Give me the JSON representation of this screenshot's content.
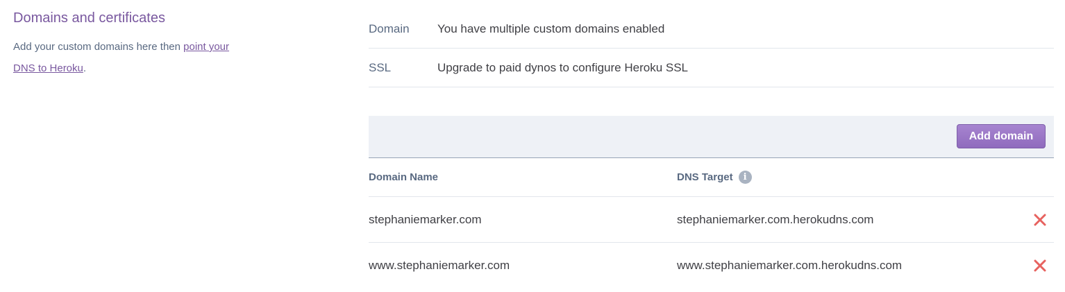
{
  "section": {
    "title": "Domains and certificates",
    "description_prefix": "Add your custom domains here then ",
    "link_text": "point your DNS to Heroku",
    "description_suffix": "."
  },
  "info_rows": [
    {
      "label": "Domain",
      "value": "You have multiple custom domains enabled"
    },
    {
      "label": "SSL",
      "value": "Upgrade to paid dynos to configure Heroku SSL"
    }
  ],
  "toolbar": {
    "add_domain_label": "Add domain"
  },
  "table": {
    "headers": {
      "domain_name": "Domain Name",
      "dns_target": "DNS Target",
      "info_icon_glyph": "i"
    },
    "rows": [
      {
        "domain": "stephaniemarker.com",
        "target": "stephaniemarker.com.herokudns.com"
      },
      {
        "domain": "www.stephaniemarker.com",
        "target": "www.stephaniemarker.com.herokudns.com"
      }
    ]
  },
  "icons": {
    "info": "info-icon",
    "delete": "close-icon"
  },
  "colors": {
    "accent": "#79589f",
    "button": "#9a78c6",
    "delete": "#e7625f",
    "toolbar_bg": "#eef1f6"
  }
}
